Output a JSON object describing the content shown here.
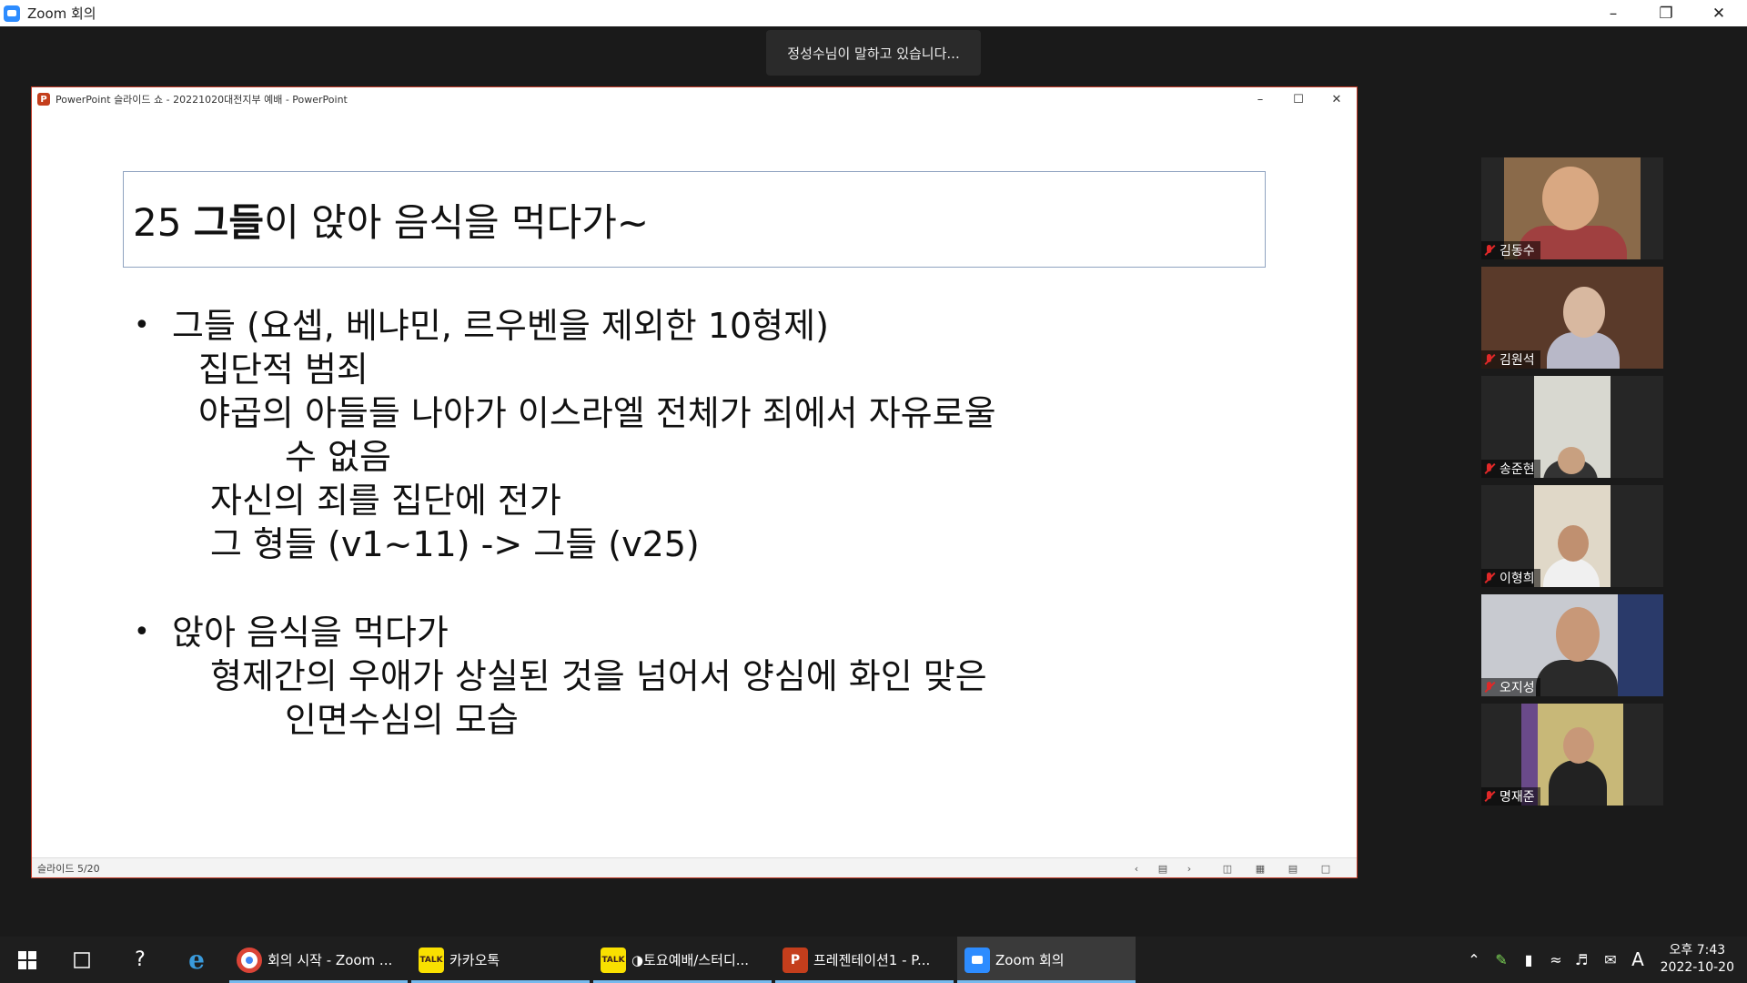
{
  "zoom": {
    "title": "Zoom 회의",
    "speaking_banner": "정성수님이 말하고 있습니다..."
  },
  "powerpoint": {
    "window_title": "PowerPoint 슬라이드 쇼  -  20221020대전지부 예배 - PowerPoint",
    "slide_number": "슬라이드 5/20",
    "slide": {
      "title_prefix": "25 ",
      "title_bold": "그들",
      "title_suffix": "이 앉아 음식을 먹다가~",
      "bullet1": "그들 (요셉, 베냐민, 르우벤을 제외한 10형제)",
      "bullet1_lines": [
        "집단적 범죄",
        "야곱의 아들들 나아가 이스라엘 전체가 죄에서 자유로울",
        "수 없음",
        "자신의 죄를 집단에 전가",
        "그 형들 (v1~11) -> 그들 (v25)"
      ],
      "bullet2": "앉아 음식을 먹다가",
      "bullet2_lines": [
        "형제간의 우애가 상실된 것을 넘어서 양심에 화인 맞은",
        "인면수심의 모습"
      ]
    }
  },
  "participants": [
    {
      "name": "김동수",
      "muted": true
    },
    {
      "name": "김원석",
      "muted": true
    },
    {
      "name": "송준현",
      "muted": true
    },
    {
      "name": "이형희",
      "muted": true
    },
    {
      "name": "오지성",
      "muted": true
    },
    {
      "name": "명재준",
      "muted": true
    }
  ],
  "taskbar": {
    "apps": [
      {
        "label": "회의 시작 - Zoom ...",
        "icon": "chrome-icon"
      },
      {
        "label": "카카오톡",
        "icon": "kakaotalk-icon"
      },
      {
        "label": "◑토요예배/스터디...",
        "icon": "kakaotalk-icon"
      },
      {
        "label": "프레젠테이션1 - P...",
        "icon": "powerpoint-icon"
      },
      {
        "label": "Zoom 회의",
        "icon": "zoom-icon"
      }
    ],
    "ime": "A",
    "time": "오후 7:43",
    "date": "2022-10-20"
  }
}
